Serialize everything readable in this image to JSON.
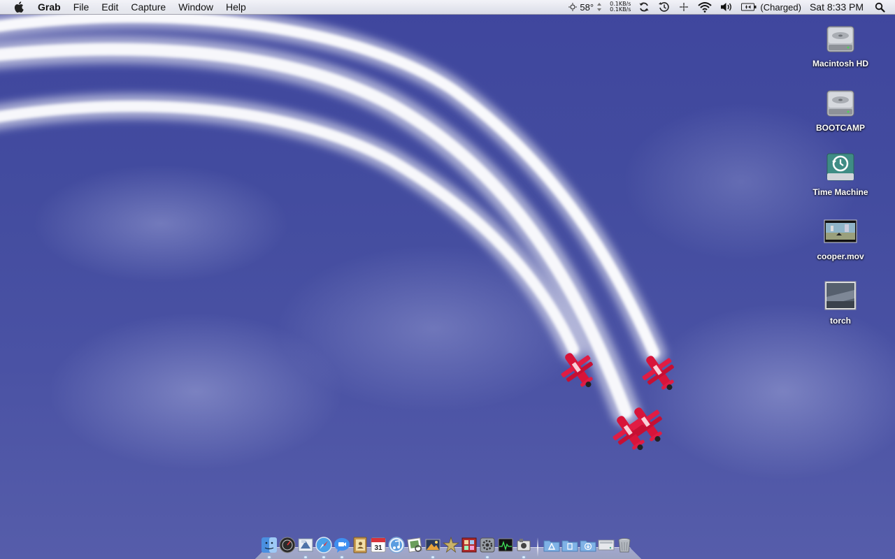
{
  "menubar": {
    "apple_icon": "apple-logo-icon",
    "app_name": "Grab",
    "menus": [
      "File",
      "Edit",
      "Capture",
      "Window",
      "Help"
    ],
    "extras": {
      "weather_temp": "58°",
      "net_up": "0.1KB/s",
      "net_down": "0.1KB/s",
      "sync_icon": "sync-icon",
      "time_machine_icon": "time-machine-icon",
      "bluetooth_icon": "bluetooth-icon",
      "wifi_icon": "wifi-icon",
      "volume_icon": "volume-icon",
      "battery_label": "(Charged)",
      "clock": "Sat 8:33 PM",
      "spotlight_icon": "spotlight-icon"
    }
  },
  "desktop": {
    "icons": [
      {
        "label": "Macintosh HD",
        "icon": "hard-drive-icon"
      },
      {
        "label": "BOOTCAMP",
        "icon": "hard-drive-icon"
      },
      {
        "label": "Time Machine",
        "icon": "time-machine-drive-icon"
      },
      {
        "label": "cooper.mov",
        "icon": "movie-file-icon"
      },
      {
        "label": "torch",
        "icon": "image-file-icon"
      }
    ]
  },
  "dock": {
    "apps": [
      "finder-icon",
      "dashboard-icon",
      "mail-icon",
      "safari-icon",
      "ichat-icon",
      "address-book-icon",
      "ical-icon",
      "itunes-icon",
      "preview-icon",
      "iphoto-icon",
      "imovie-icon",
      "photo-booth-icon",
      "system-preferences-icon",
      "activity-monitor-icon",
      "grab-icon"
    ],
    "stacks": [
      "applications-folder-icon",
      "documents-folder-icon",
      "downloads-folder-icon",
      "network-icon",
      "trash-icon"
    ]
  },
  "colors": {
    "sky_top": "#3f469e",
    "sky_bottom": "#565daa",
    "smoke": "#ffffff",
    "plane_red": "#d8143a"
  }
}
